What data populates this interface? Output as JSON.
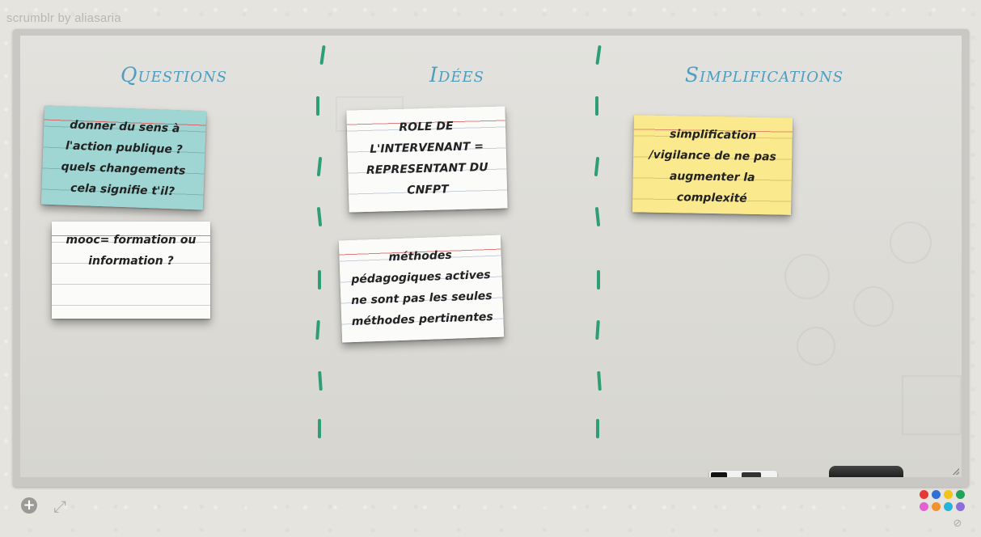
{
  "app": {
    "title": "scrumblr by  aliasaria"
  },
  "columns": [
    {
      "header": "Questions"
    },
    {
      "header": "Idées"
    },
    {
      "header": "Simplifications"
    }
  ],
  "cards": [
    {
      "color": "teal",
      "text": "donner du sens à l'action publique ? quels changements cela signifie t'il?"
    },
    {
      "color": "white",
      "text": "mooc= formation ou information ?"
    },
    {
      "color": "white",
      "text": "ROLE DE L'INTERVENANT = REPRESENTANT DU CNFPT"
    },
    {
      "color": "white",
      "text": "méthodes pédagogiques actives ne sont pas les seules méthodes pertinentes"
    },
    {
      "color": "yellow",
      "text": "simplification /vigilance de ne pas augmenter la complexité"
    }
  ],
  "controls": {
    "add_icon": "plus-circle-icon",
    "expand_icon": "expand-arrows-icon",
    "no_color_icon": "no-symbol-icon"
  },
  "palette": [
    "#e53935",
    "#2f6fd6",
    "#f2c318",
    "#23a35a",
    "#e55fd8",
    "#f09230",
    "#21b6d9",
    "#8e6fd8"
  ],
  "colors": {
    "header_text": "#4f9dbf",
    "divider": "#2e9e78",
    "note_teal": "#9fd6d3",
    "note_white": "#fbfbf9",
    "note_yellow": "#fbe98e"
  }
}
